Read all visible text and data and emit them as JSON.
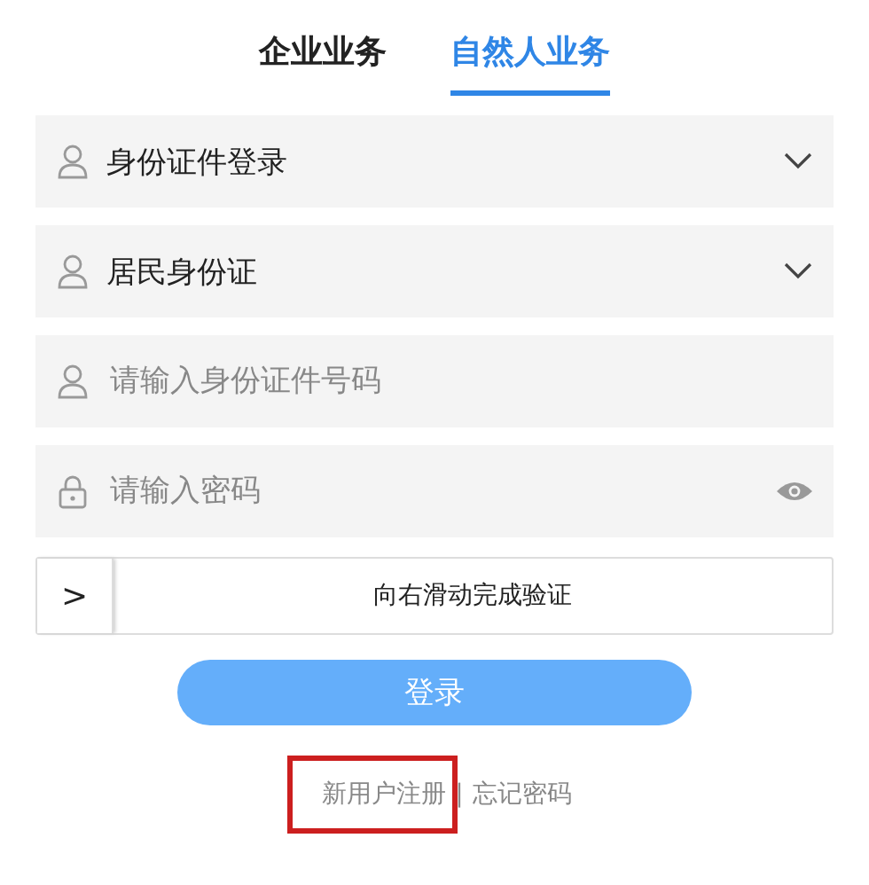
{
  "tabs": [
    {
      "label": "企业业务",
      "selected": false
    },
    {
      "label": "自然人业务",
      "selected": true
    }
  ],
  "fields": [
    {
      "kind": "select",
      "value": "身份证件登录"
    },
    {
      "kind": "select",
      "value": "居民身份证"
    },
    {
      "kind": "input",
      "placeholder": "请输入身份证件号码"
    },
    {
      "kind": "password",
      "placeholder": "请输入密码"
    }
  ],
  "slider": {
    "handle": ">",
    "label": "向右滑动完成验证"
  },
  "login_button": "登录",
  "links": [
    {
      "label": "新用户注册",
      "highlighted": true
    },
    {
      "label": "忘记密码",
      "highlighted": false
    }
  ],
  "link_separator": "|"
}
